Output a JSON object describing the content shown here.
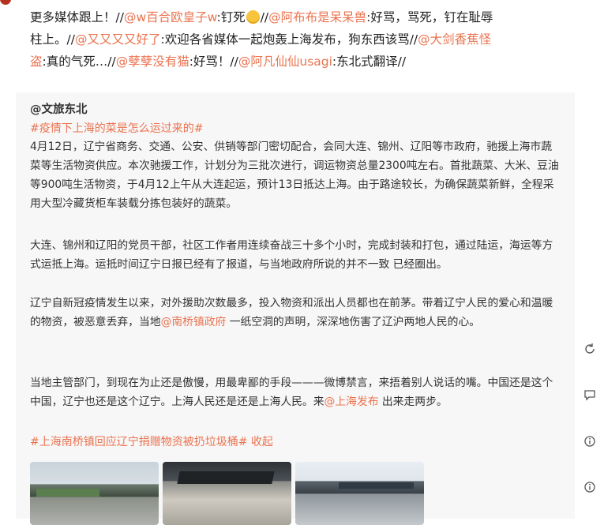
{
  "post": {
    "line1_a": "更多媒体跟上！//",
    "mention1": "@w百合欧皇子w",
    "line1_b": ":钉死",
    "line1_c": "//",
    "mention2": "@阿布布是呆呆兽",
    "line1_d": ":好骂，骂死，钉在耻辱",
    "line2_a": "柱上。//",
    "mention3": "@又又又又好了",
    "line2_b": ":欢迎各省媒体一起炮轰上海发布，狗东西该骂//",
    "mention4": "@大剑香蕉怪",
    "line3_a": "盗",
    "line3_b": ":真的气死…//",
    "mention5": "@孽孽没有猫",
    "line3_c": ":好骂！//",
    "mention6": "@阿凡仙仙usagi",
    "line3_d": ":东北式翻译//"
  },
  "repost": {
    "author": "@文旅东北",
    "topic": "#疫情下上海的菜是怎么运过来的#",
    "para1": "    4月12日，辽宁省商务、交通、公安、供销等部门密切配合，会同大连、锦州、辽阳等市政府，驰援上海市蔬菜等生活物资供应。本次驰援工作，计划分为三批次进行，调运物资总量2300吨左右。首批蔬菜、大米、豆油等900吨生活物资，于4月12上午从大连起运，预计13日抵达上海。由于路途较长，为确保蔬菜新鲜，全程采用大型冷藏货柜车装载分拣包装好的蔬菜。",
    "para2": " 大连、锦州和辽阳的党员干部，社区工作者用连续奋战三十多个小时，完成封装和打包，通过陆运，海运等方式运抵上海。运抵时间辽宁日报已经有了报道，与当地政府所说的并不一致  已经圈出。",
    "para3_a": "    辽宁自新冠疫情发生以来，对外援助次数最多，投入物资和派出人员都也在前茅。带着辽宁人民的爱心和温暖的物资，被恶意丢弃，当地",
    "para3_mention": "@南桥镇政府",
    "para3_b": " 一纸空洞的声明，深深地伤害了辽沪两地人民的心。",
    "para4_a": " 当地主管部门，到现在为止还是傲慢，用最卑鄙的手段———微博禁言，来捂着别人说话的嘴。中国还是这个中国，辽宁也还是这个辽宁。上海人民还是还是上海人民。来",
    "para4_mention": "@上海发布",
    "para4_b": " 出来走两步。",
    "tag_topic": "#上海南桥镇回应辽宁捐赠物资被扔垃圾桶#",
    "collapse": "收起"
  },
  "side_icons": [
    "refresh-icon",
    "chat-icon",
    "info-icon",
    "info-icon"
  ],
  "colors": {
    "link": "#eb7350",
    "repost_bg": "#f7f7f7"
  }
}
